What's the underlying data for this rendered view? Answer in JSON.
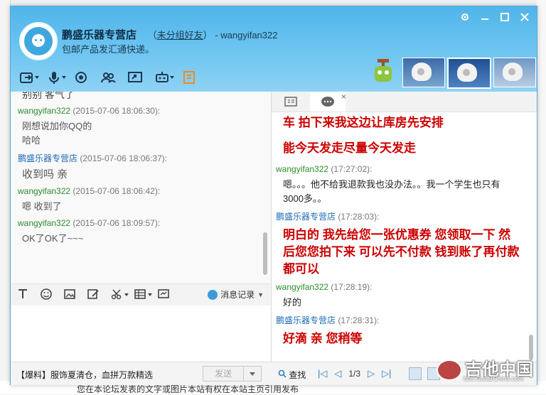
{
  "background": {
    "footer_text": "您在本论坛发表的文字或图片本站有权在本站主页引用发布"
  },
  "window": {
    "contact_name": "鹏盛乐器专营店",
    "group_open": "（",
    "group_label": "未分组好友",
    "group_close": "）",
    "account": "- wangyifan322",
    "signature": "包邮产品发汇通快递。"
  },
  "left_chat": {
    "messages": [
      {
        "sender": "",
        "time": "",
        "text": "别别 客气了",
        "partial": true
      },
      {
        "sender": "wangyifan322",
        "time": "(2015-07-06 18:06:30):",
        "lines": [
          "刚想说加你QQ的",
          "哈哈"
        ]
      },
      {
        "sender": "鹏盛乐器专营店",
        "time": "(2015-07-06 18:06:37):",
        "lines": [
          "收到吗 亲"
        ]
      },
      {
        "sender": "wangyifan322",
        "time": "(2015-07-06 18:06:42):",
        "lines": [
          "嗯 收到了"
        ]
      },
      {
        "sender": "wangyifan322",
        "time": "(2015-07-06 18:09:57):",
        "lines": [
          "OK了OK了~~~"
        ]
      }
    ]
  },
  "editor": {
    "history_label": "消息记录"
  },
  "right_chat": {
    "tab_close": "×",
    "messages": [
      {
        "lines": [
          "车 拍下来我这边让库房先安排"
        ]
      },
      {
        "lines": [
          "能今天发走尽量今天发走"
        ]
      },
      {
        "sender": "wangyifan322",
        "time": "(17:27:02):",
        "lines": [
          "嗯。。。他不给我退款我也没办法。。我一个学生也只有",
          "3000多。。"
        ]
      },
      {
        "sender": "鹏盛乐器专营店",
        "time": "(17:28:03):",
        "lines": [
          "明白的  我先给您一张优惠券 您领取一下 然",
          "后您您拍下来 可以先不付款 钱到账了再付款",
          "都可以"
        ]
      },
      {
        "sender": "wangyifan322",
        "time": "(17:28:19):",
        "lines": [
          "好的"
        ]
      },
      {
        "sender": "鹏盛乐器专营店",
        "time": "(17:28:31):",
        "lines": [
          "好滴 亲 您稍等"
        ]
      }
    ]
  },
  "bottom_bar": {
    "ad_text": "【爆料】服饰夏清仓，血拼万款精选",
    "send_label": "发送",
    "find_label": "查找",
    "page_indicator": "1/3"
  },
  "watermark": {
    "title": "吉他中国",
    "url": "bbs.GuitarChina.com"
  },
  "colors": {
    "header_blue": "#4fb5ea",
    "self_name": "#2a8d2a",
    "shop_name": "#1e6bb8",
    "shop_message_red": "#cc0000"
  }
}
